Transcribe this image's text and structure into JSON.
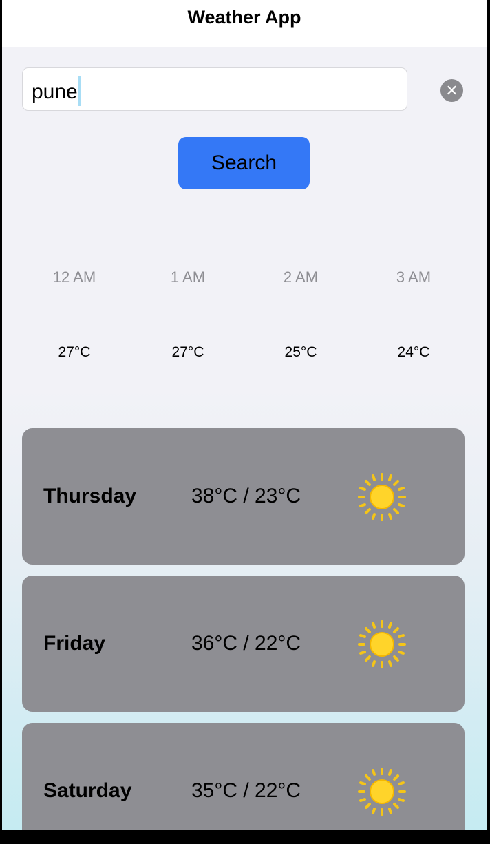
{
  "app": {
    "title": "Weather App"
  },
  "search": {
    "value": "pune",
    "button_label": "Search",
    "clear_icon": "clear-icon"
  },
  "hourly": [
    {
      "time": "12 AM",
      "icon": "moon-icon",
      "temp": "27°C"
    },
    {
      "time": "1 AM",
      "icon": "moon-icon",
      "temp": "27°C"
    },
    {
      "time": "2 AM",
      "icon": "moon-icon",
      "temp": "25°C"
    },
    {
      "time": "3 AM",
      "icon": "moon-icon",
      "temp": "24°C"
    }
  ],
  "daily": [
    {
      "day": "Thursday",
      "temps": "38°C / 23°C",
      "icon": "sun-icon"
    },
    {
      "day": "Friday",
      "temps": "36°C / 22°C",
      "icon": "sun-icon"
    },
    {
      "day": "Saturday",
      "temps": "35°C / 22°C",
      "icon": "sun-icon"
    }
  ],
  "colors": {
    "accent": "#3478f6",
    "card": "#8e8e93",
    "moon": "#2f6fdc",
    "sun": "#f5c518"
  }
}
